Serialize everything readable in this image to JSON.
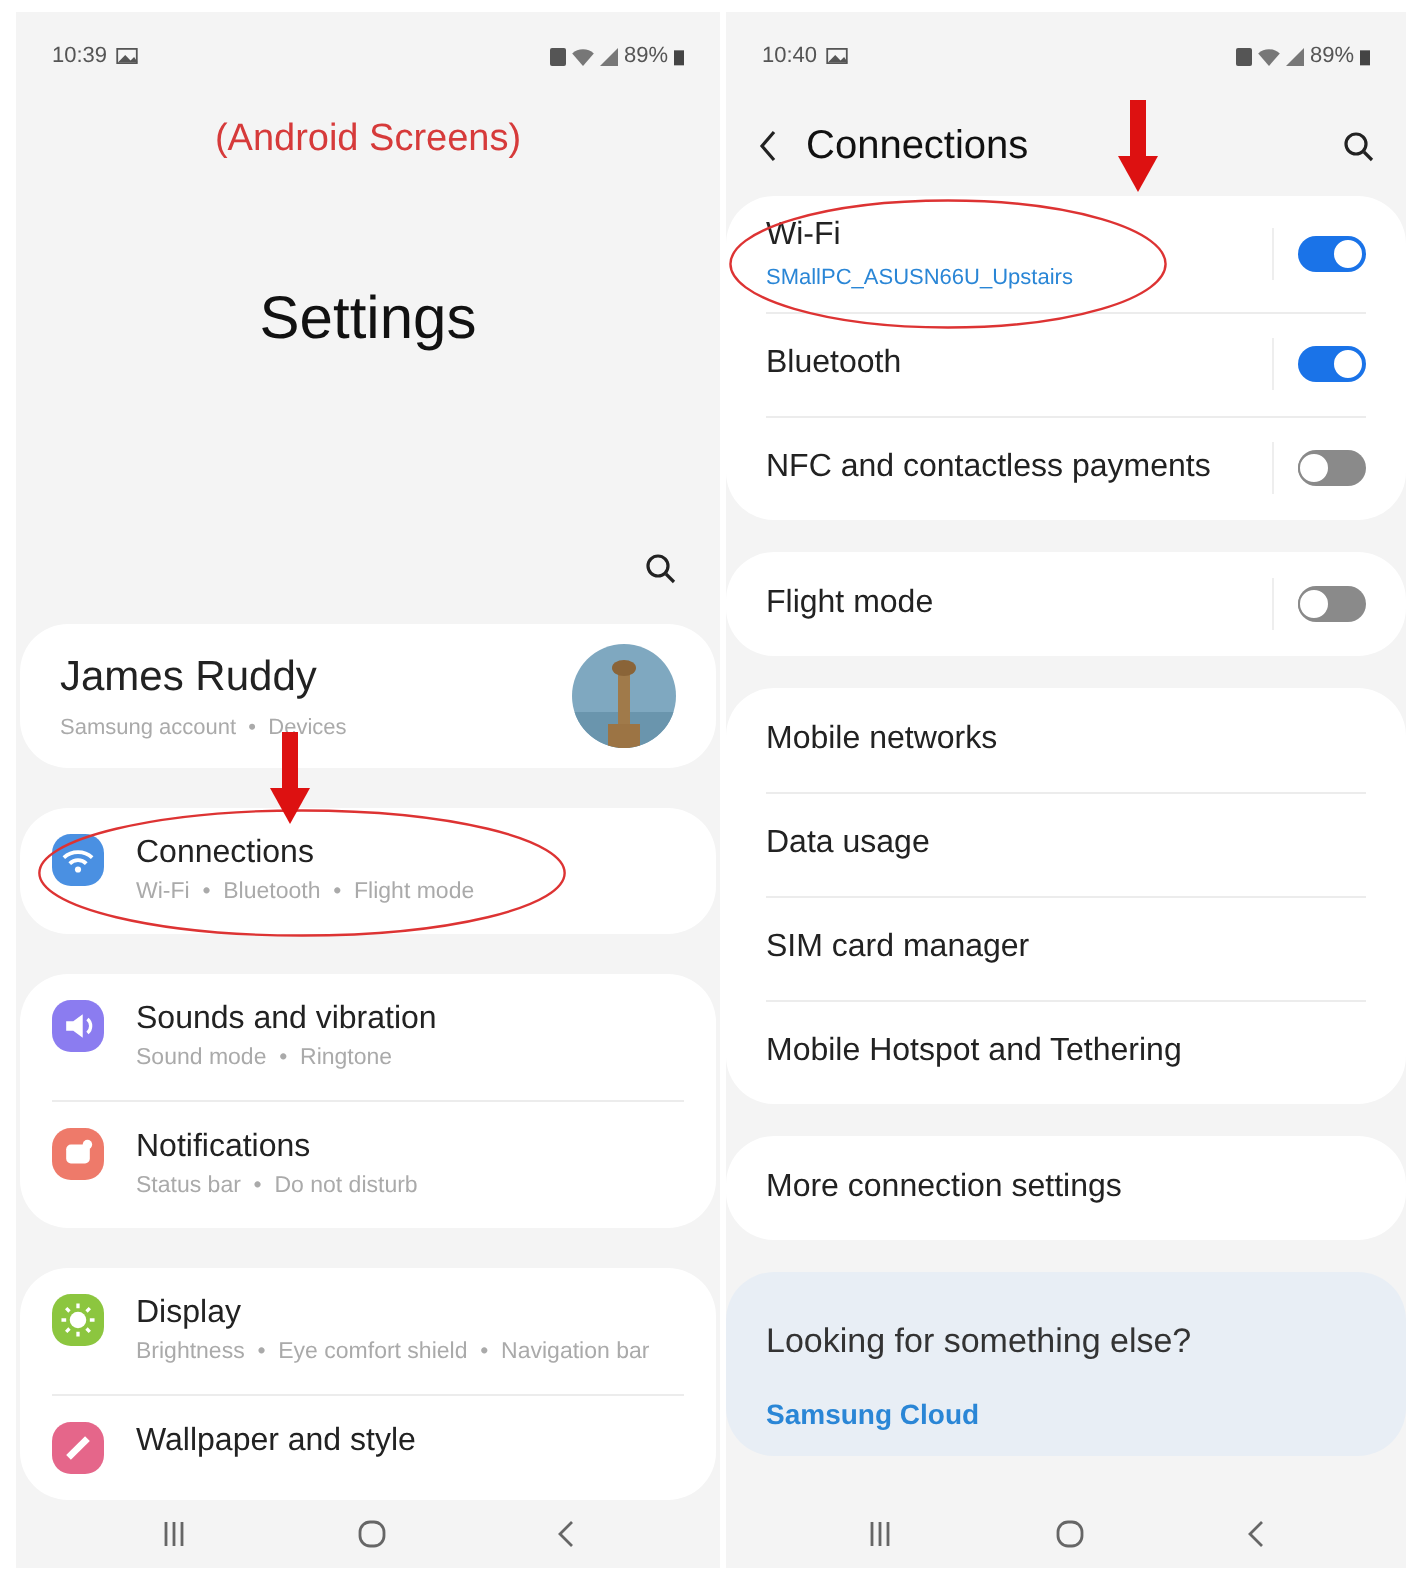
{
  "annotation": {
    "label": "(Android Screens)"
  },
  "settings_screen": {
    "status_bar": {
      "time": "10:39",
      "battery": "89%"
    },
    "title": "Settings",
    "profile": {
      "name": "James Ruddy",
      "subtitle": "Samsung account  •  Devices"
    },
    "groups": [
      [
        {
          "title": "Connections",
          "subtitle": "Wi-Fi  •  Bluetooth  •  Flight mode",
          "kind": "wifi",
          "color": "#4a90e2",
          "highlighted": true
        }
      ],
      [
        {
          "title": "Sounds and vibration",
          "subtitle": "Sound mode  •  Ringtone",
          "kind": "speaker",
          "color": "#8b7cf0",
          "highlighted": false
        },
        {
          "title": "Notifications",
          "subtitle": "Status bar  •  Do not disturb",
          "kind": "bell",
          "color": "#ee7a6a",
          "highlighted": false
        }
      ],
      [
        {
          "title": "Display",
          "subtitle": "Brightness  •  Eye comfort shield  •  Navigation bar",
          "kind": "sun",
          "color": "#8cc63f",
          "highlighted": false
        },
        {
          "title": "Wallpaper and style",
          "kind": "brush",
          "color": "#e5668a",
          "highlighted": false
        }
      ]
    ]
  },
  "connections_screen": {
    "status_bar": {
      "time": "10:40",
      "battery": "89%"
    },
    "title": "Connections",
    "groups": [
      [
        {
          "title": "Wi-Fi",
          "subtitle": "SMallPC_ASUSN66U_Upstairs",
          "on": true,
          "highlighted": true
        },
        {
          "title": "Bluetooth",
          "on": true,
          "highlighted": false
        },
        {
          "title": "NFC and contactless payments",
          "on": false,
          "highlighted": false
        }
      ],
      [
        {
          "title": "Flight mode",
          "on": false,
          "highlighted": false
        }
      ],
      [
        {
          "title": "Mobile networks"
        },
        {
          "title": "Data usage"
        },
        {
          "title": "SIM card manager"
        },
        {
          "title": "Mobile Hotspot and Tethering"
        }
      ],
      [
        {
          "title": "More connection settings"
        }
      ]
    ],
    "suggestion": {
      "heading": "Looking for something else?",
      "link": "Samsung Cloud"
    }
  }
}
